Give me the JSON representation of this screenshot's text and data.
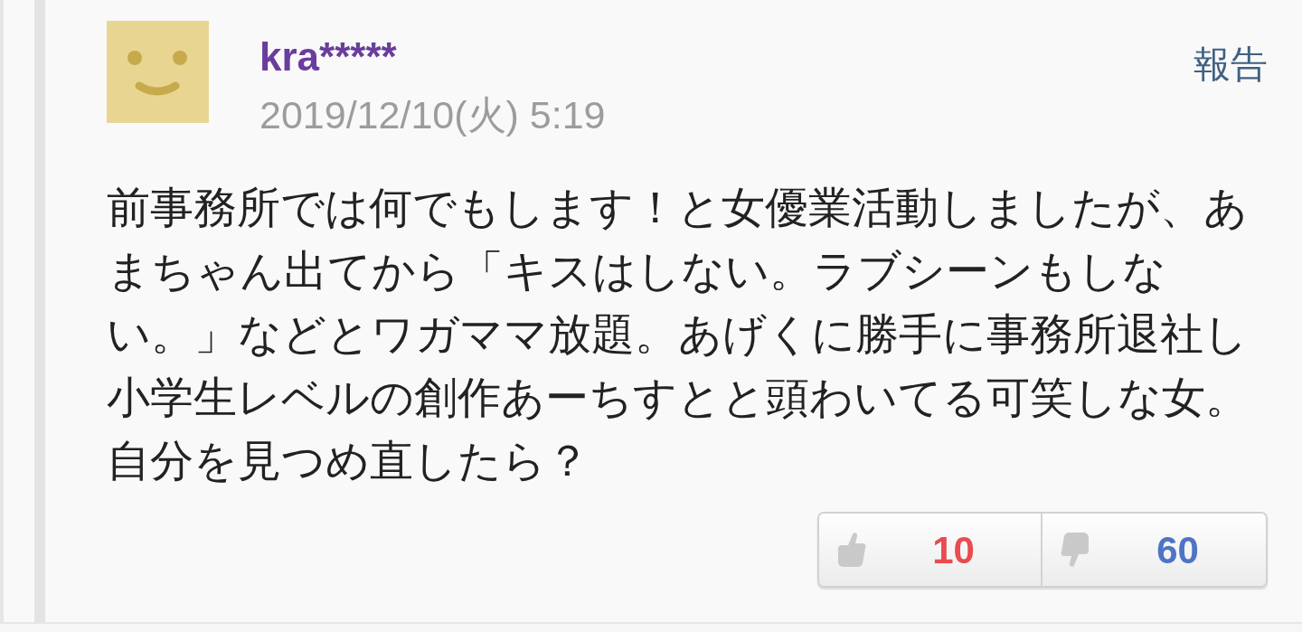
{
  "comment": {
    "author": "kra*****",
    "date": "2019/12/10(火) 5:19",
    "report": "報告",
    "body": "前事務所では何でもします！と女優業活動しましたが、あまちゃん出てから「キスはしない。ラブシーンもしない。」などとワガママ放題。あげくに勝手に事務所退社し小学生レベルの創作あーちすとと頭わいてる可笑しな女。自分を見つめ直したら？",
    "votes": [
      {
        "kind": "up",
        "count": "10"
      },
      {
        "kind": "down",
        "count": "60"
      }
    ]
  }
}
